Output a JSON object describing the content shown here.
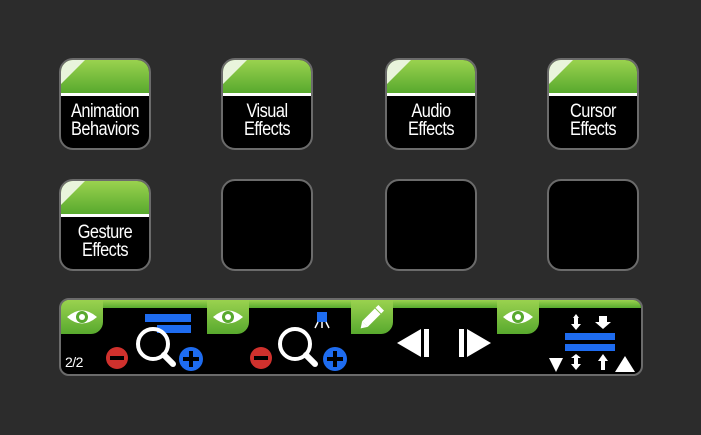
{
  "keys": [
    {
      "line1": "Animation",
      "line2": "Behaviors"
    },
    {
      "line1": "Visual",
      "line2": "Effects"
    },
    {
      "line1": "Audio",
      "line2": "Effects"
    },
    {
      "line1": "Cursor",
      "line2": "Effects"
    },
    {
      "line1": "Gesture",
      "line2": "Effects"
    }
  ],
  "strip": {
    "page_indicator": "2/2"
  },
  "colors": {
    "background": "#2c2c2c",
    "key_green": "#6cba37",
    "blue": "#1e6cf0",
    "red": "#d0312d"
  },
  "icons": [
    "eye-icon",
    "zoom-icon",
    "pencil-icon",
    "previous-icon",
    "next-icon",
    "layout-icon"
  ]
}
